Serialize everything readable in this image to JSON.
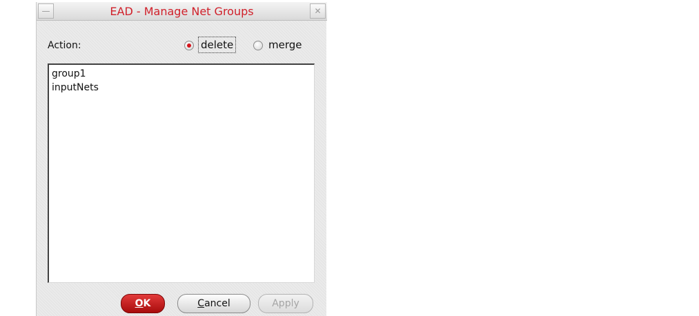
{
  "window": {
    "title": "EAD - Manage Net Groups",
    "minimize_glyph": "—",
    "close_glyph": "✕"
  },
  "action": {
    "label": "Action:",
    "options": [
      {
        "label": "delete",
        "selected": true
      },
      {
        "label": "merge",
        "selected": false
      }
    ]
  },
  "net_groups": {
    "items": [
      "group1",
      "inputNets"
    ]
  },
  "buttons": {
    "ok": {
      "mnemonic": "O",
      "rest": "K",
      "enabled": true
    },
    "cancel": {
      "mnemonic": "C",
      "rest": "ancel",
      "enabled": true
    },
    "apply": {
      "label": "Apply",
      "enabled": false
    }
  },
  "colors": {
    "title_text": "#d0202a",
    "radio_selected": "#d4141c",
    "ok_button": "#c41e1e",
    "disabled_text": "#a5a5a5"
  },
  "icons": {
    "minimize": "minimize-icon",
    "close": "close-icon"
  }
}
